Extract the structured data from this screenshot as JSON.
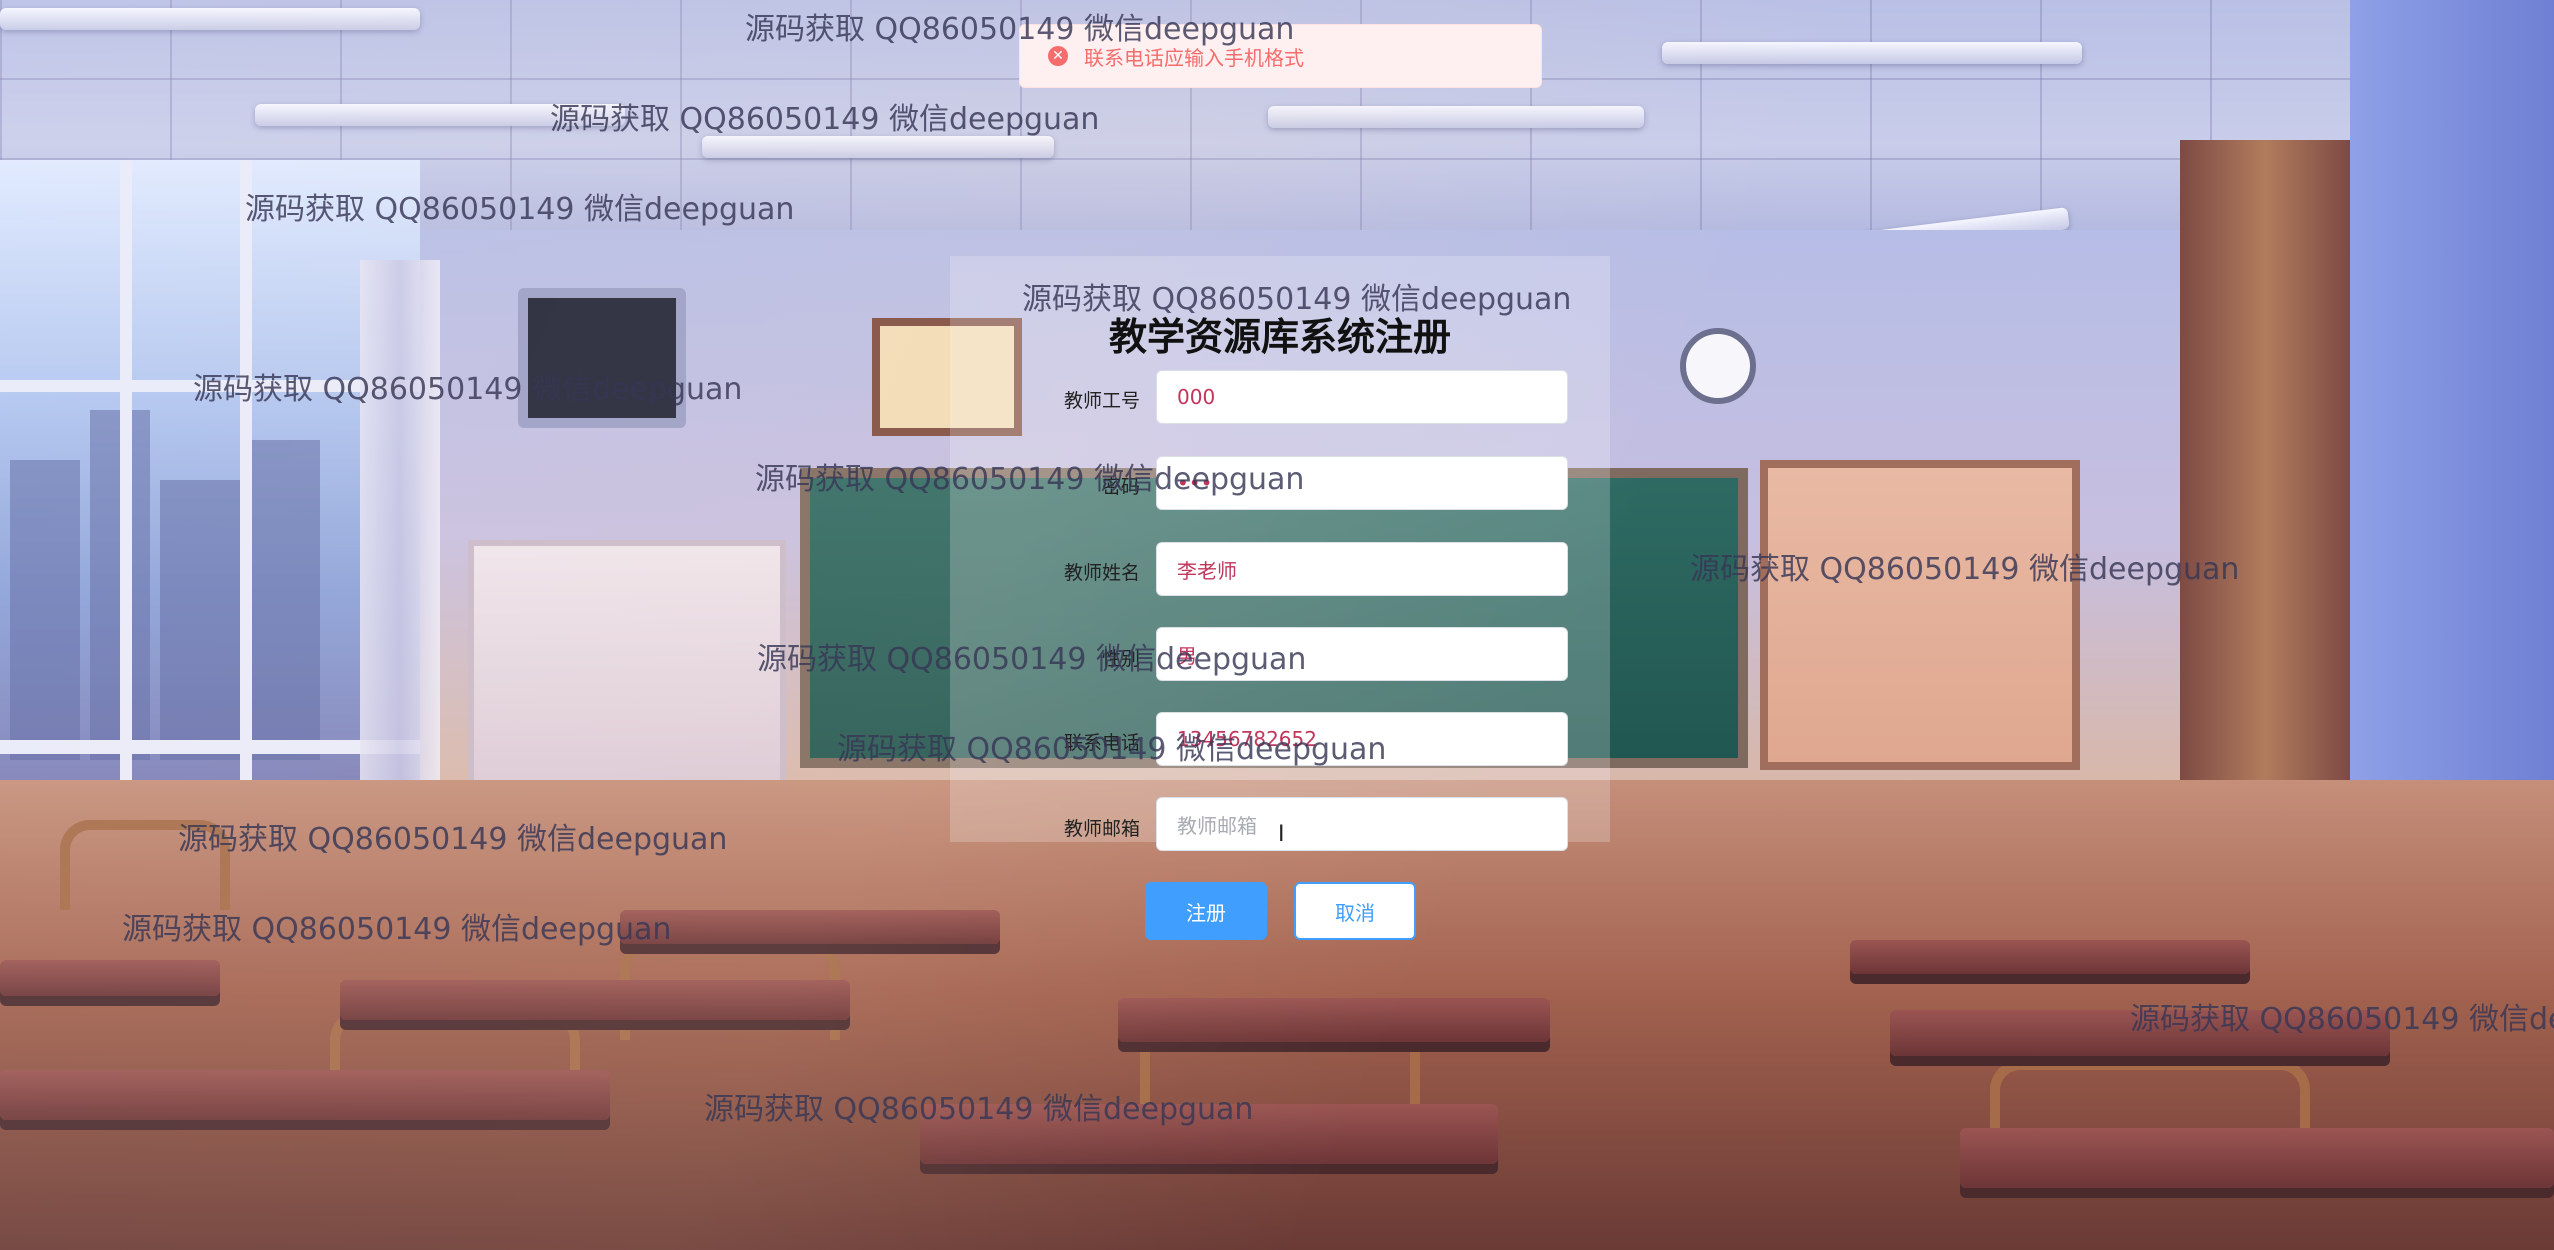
{
  "toast": {
    "message": "联系电话应输入手机格式",
    "icon": "error-circle-icon"
  },
  "form": {
    "title": "教学资源库系统注册",
    "fields": [
      {
        "label": "教师工号",
        "value": "000",
        "placeholder": ""
      },
      {
        "label": "密码",
        "value": "•••",
        "placeholder": ""
      },
      {
        "label": "教师姓名",
        "value": "李老师",
        "placeholder": ""
      },
      {
        "label": "性别",
        "value": "男",
        "placeholder": ""
      },
      {
        "label": "联系电话",
        "value": "13456782652",
        "placeholder": ""
      },
      {
        "label": "教师邮箱",
        "value": "",
        "placeholder": "教师邮箱"
      }
    ],
    "submit_label": "注册",
    "cancel_label": "取消"
  },
  "watermark": "源码获取 QQ86050149 微信deepguan",
  "colors": {
    "primary": "#409eff",
    "error": "#f56c6c",
    "error_bg": "#fef0f0",
    "input_text": "#c0365c"
  }
}
